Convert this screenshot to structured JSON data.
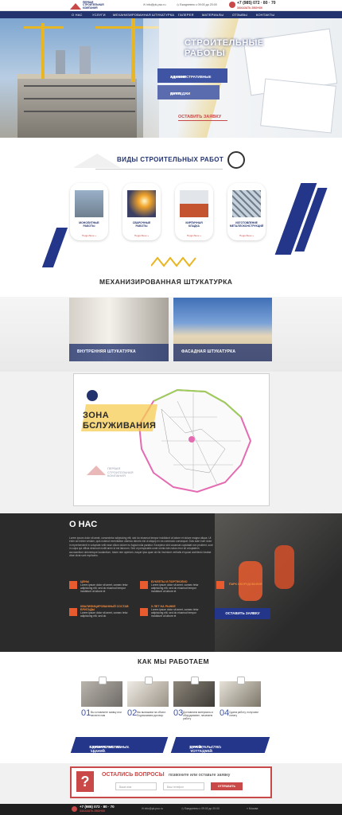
{
  "header": {
    "logo_text": "ПЕРВАЯ СТРОИТЕЛЬНАЯ КОМПАНИЯ",
    "email": "info@pk-pso.ru",
    "hours": "Ежедневно с 09:00 до 20:00",
    "phone": "+7 (985) 072 · 80 · 70",
    "callback": "ЗАКАЗАТЬ ЗВОНОК"
  },
  "nav": [
    "О НАС",
    "УСЛУГИ",
    "МЕХАНИЗИРОВАННАЯ ШТУКАТУРКА",
    "ГАЛЕРЕЯ",
    "МАТЕРИАЛЫ",
    "ОТЗЫВЫ",
    "КОНТАКТЫ"
  ],
  "hero": {
    "title_line1": "СТРОИТЕЛЬНЫЕ",
    "title_line2": "РАБОТЫ",
    "btn1_line1": "АДМИНИСТРАТИВНЫЕ",
    "btn1_line2": "ЗДАНИЯ",
    "btn2_line1": "ДАЧИ,",
    "btn2_line2": "КОТТЕДЖИ",
    "cta": "ОСТАВИТЬ ЗАЯВКУ"
  },
  "services": {
    "title": "ВИДЫ СТРОИТЕЛЬНЫХ РАБОТ",
    "cards": [
      {
        "l1": "МОНОЛИТНЫЕ",
        "l2": "РАБОТЫ",
        "more": "Подробнее »"
      },
      {
        "l1": "СВАРОЧНЫЕ",
        "l2": "РАБОТЫ",
        "more": "Подробнее »"
      },
      {
        "l1": "КИРПИЧНАЯ",
        "l2": "КЛАДКА",
        "more": "Подробнее »"
      },
      {
        "l1": "ИЗГОТОВЛЕНИЕ",
        "l2": "МЕТАЛЛОКОНСТРУКЦИЙ",
        "more": "Подробнее »"
      }
    ]
  },
  "plaster": {
    "title": "МЕХАНИЗИРОВАННАЯ ШТУКАТУРКА",
    "inner": "ВНУТРЕННЯЯ ШТУКАТУРКА",
    "facade": "ФАСАДНАЯ ШТУКАТУРКА"
  },
  "zone": {
    "line1": "ЗОНА",
    "line2": "БСЛУЖИВАНИЯ",
    "watermark": "ПЕРВАЯ СТРОИТЕЛЬНАЯ КОМПАНИЯ"
  },
  "about": {
    "title": "О НАС",
    "text": "Lorem ipsum dolor sit amet, consectetur adipisicing elit, sed do eiusmod tempor incididunt ut labore et dolore magna aliqua. Ut enim ad minim veniam, quis nostrud exercitation ullamco laboris nisi ut aliquip ex ea commodo consequat. Duis aute irure dolor in reprehenderit in voluptate velit esse cillum dolore eu fugiat nulla pariatur. Excepteur sint occaecat cupidatat non proident, sunt in culpa qui officia deserunt mollit anim id est laborum. Sed ut perspiciatis unde omnis iste natus error sit voluptatem accusantium doloremque laudantium, totam rem aperiam, eaque ipsa quae ab illo inventore veritatis et quasi architecto beatae vitae dicta sunt explicabo.",
    "features": [
      {
        "title": "ЦЕНЫ",
        "text": "Lorem ipsum dolor sit amet, consec tetur adipisicing elit, sed do eiusmod tempor incididunt ut labore et"
      },
      {
        "title": "БУКЛЕТЫ И ПОРТФОЛИО",
        "text": "Lorem ipsum dolor sit amet, consec tetur adipisicing elit, sed do eiusmod tempor incididunt ut labore et"
      },
      {
        "title": "ПАРК ОБОРУДОВАНИЯ",
        "text": ""
      },
      {
        "title": "КВАЛИФИЦИРОВАННЫЙ СОСТАВ БРИГАДЫ",
        "text": "Lorem ipsum dolor sit amet, consec tetur adipisicing elit, sed do"
      },
      {
        "title": "X ЛЕТ НА РЫНКЕ",
        "text": "Lorem ipsum dolor sit amet, consec tetur adipisicing elit, sed do eiusmod tempor incididunt ut labore et"
      }
    ],
    "cta": "ОСТАВИТЬ ЗАЯВКУ"
  },
  "how": {
    "title": "КАК МЫ РАБОТАЕМ",
    "steps": [
      {
        "num": "01",
        "text": "Вы оставляете заявку или звоните нам"
      },
      {
        "num": "02",
        "text": "Мы выезжаем на объект. Подписываем договор"
      },
      {
        "num": "03",
        "text": "Доставляем материалы и оборудование, начинаем работу"
      },
      {
        "num": "04",
        "text": "Сдаем работу, получаем оплату"
      }
    ]
  },
  "bottom_buttons": {
    "b1_line1": "СТРОИТЕЛЬСТВО",
    "b1_line2": "АДМИНИСТРАТИВНЫХ ЗДАНИЙ",
    "b2_line1": "СТРОИТЕЛЬСТВО",
    "b2_line2": "ДАЧЕЙ, КОТТЕДЖЕЙ"
  },
  "question": {
    "title": "ОСТАЛИСЬ ВОПРОСЫ",
    "subtitle": "позвоните или оставьте заявку",
    "name_placeholder": "Ваше имя",
    "phone_placeholder": "Ваш телефон",
    "send": "ОТПРАВИТЬ"
  },
  "footer": {
    "phone": "+7 (985) 072 · 80 · 70",
    "callback": "ЗАКАЗАТЬ ЗВОНОК",
    "email": "info@pk-pso.ru",
    "hours": "Ежедневно с 09:00 до 20:00",
    "city": "Москва"
  },
  "colors": {
    "navy": "#23336e",
    "blue": "#24368a",
    "red": "#c94848",
    "orange": "#e85b2e"
  }
}
